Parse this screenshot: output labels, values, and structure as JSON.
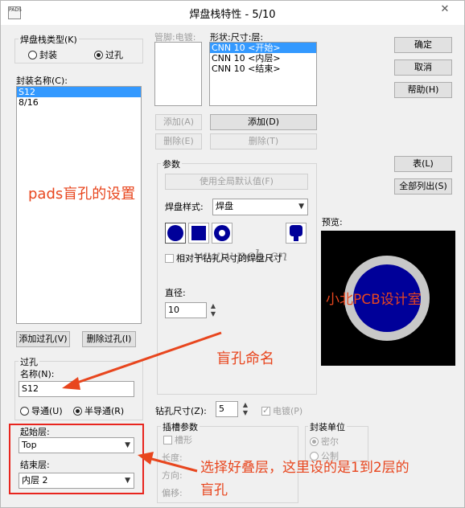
{
  "window": {
    "title": "焊盘栈特性 - 5/10",
    "icon_text": "PADS",
    "close": "✕",
    "icon": "pads-app-icon"
  },
  "stack_type": {
    "group_label": "焊盘栈类型(K)",
    "options": [
      {
        "label": "封装",
        "checked": false
      },
      {
        "label": "过孔",
        "checked": true
      }
    ]
  },
  "package_name": {
    "label": "封装名称(C):",
    "items": [
      {
        "text": "S12",
        "selected": true
      },
      {
        "text": "8/16",
        "selected": false
      }
    ]
  },
  "pin_electrical": {
    "label": "管脚:电镀:"
  },
  "shape_size_layer": {
    "label": "形状:尺寸:层:",
    "items": [
      "CNN 10 <开始>",
      "CNN 10 <内层>",
      "CNN 10 <结束>"
    ]
  },
  "pin_buttons": {
    "add": "添加(A)",
    "delete": "删除(E)"
  },
  "layer_buttons": {
    "add": "添加(D)",
    "delete": "删除(T)"
  },
  "right_buttons": {
    "ok": "确定",
    "cancel": "取消",
    "help": "帮助(H)",
    "table": "表(L)",
    "list_all": "全部列出(S)"
  },
  "params": {
    "group_label": "参数",
    "use_global": "使用全局默认值(F)",
    "pad_style_label": "焊盘样式:",
    "pad_style_value": "焊盘",
    "relative_check": "相对于钻孔尺寸的焊盘尺寸",
    "diameter_label": "直径:",
    "diameter_value": "10",
    "watermark": "www.pcb.cn"
  },
  "preview": {
    "label": "预览:"
  },
  "via": {
    "group_label": "过孔",
    "name_label": "名称(N):",
    "name_value": "S12",
    "add_via": "添加过孔(V)",
    "delete_via": "删除过孔(I)",
    "options": [
      {
        "label": "导通(U)",
        "checked": false
      },
      {
        "label": "半导通(R)",
        "checked": true
      }
    ],
    "start_layer_label": "起始层:",
    "start_layer_value": "Top",
    "end_layer_label": "结束层:",
    "end_layer_value": "内层 2"
  },
  "drill": {
    "label": "钻孔尺寸(Z):",
    "value": "5",
    "plated_label": "电镀(P)",
    "plated": true
  },
  "slot": {
    "group_label": "插槽参数",
    "slot_check": "槽形",
    "length_label": "长度:",
    "direction_label": "方向:",
    "offset_label": "偏移:"
  },
  "package_unit": {
    "group_label": "封装单位",
    "options": [
      {
        "label": "密尔",
        "checked": true
      },
      {
        "label": "公制",
        "checked": false
      }
    ]
  },
  "annotations": {
    "blind_via_setup": "pads盲孔的设置",
    "brand": "小北PCB设计室",
    "blind_via_naming": "盲孔命名",
    "select_layers_line1": "选择好叠层，这里设的是1到2层的",
    "select_layers_line2": "盲孔"
  },
  "colors": {
    "annotation": "#e8461e",
    "pad_fill": "#000099",
    "pad_ring": "#c8c8c8",
    "highlight_box": "#e8251e",
    "selection": "#3399ff"
  }
}
